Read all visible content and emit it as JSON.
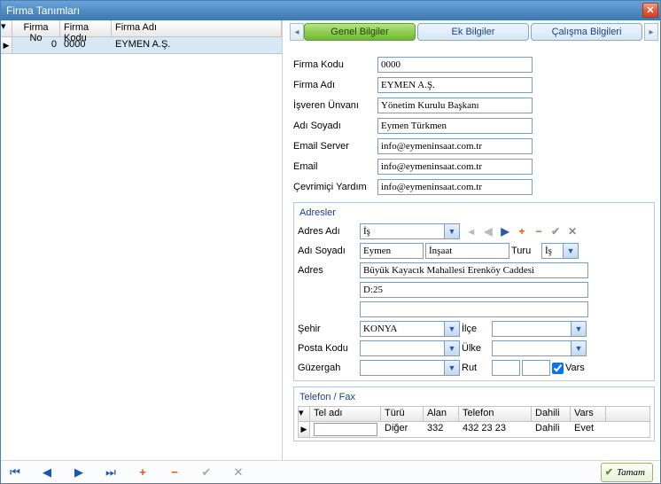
{
  "window": {
    "title": "Firma Tanımları"
  },
  "grid": {
    "columns": {
      "no": "Firma No",
      "kodu": "Firma Kodu",
      "adi": "Firma Adı"
    },
    "rows": [
      {
        "no": "0",
        "kodu": "0000",
        "adi": "EYMEN A.Ş."
      }
    ]
  },
  "tabs": {
    "genel": "Genel Bilgiler",
    "ek": "Ek Bilgiler",
    "calisma": "Çalışma Bilgileri"
  },
  "form": {
    "labels": {
      "firma_kodu": "Firma Kodu",
      "firma_adi": "Firma Adı",
      "isveren_unvani": "İşveren Ünvanı",
      "adi_soyadi": "Adı Soyadı",
      "email_server": "Email Server",
      "email": "Email",
      "cevrimici": "Çevrimiçi Yardım"
    },
    "values": {
      "firma_kodu": "0000",
      "firma_adi": "EYMEN A.Ş.",
      "isveren_unvani": "Yönetim Kurulu Başkanı",
      "adi_soyadi": "Eymen Türkmen",
      "email_server": "info@eymeninsaat.com.tr",
      "email": "info@eymeninsaat.com.tr",
      "cevrimici": "info@eymeninsaat.com.tr"
    }
  },
  "address": {
    "legend": "Adresler",
    "labels": {
      "adres_adi": "Adres Adı",
      "adi_soyadi": "Adı Soyadı",
      "turu": "Turu",
      "adres": "Adres",
      "sehir": "Şehir",
      "ilce": "İlçe",
      "posta": "Posta Kodu",
      "ulke": "Ülke",
      "guzergah": "Güzergah",
      "rut": "Rut",
      "vars": "Vars"
    },
    "values": {
      "adres_adi": "İş",
      "ad": "Eymen",
      "soyad": "İnşaat",
      "turu": "İş",
      "adres1": "Büyük Kayacık Mahallesi Erenköy Caddesi",
      "adres2": "D:25",
      "adres3": "",
      "sehir": "KONYA",
      "ilce": "",
      "posta": "",
      "ulke": "",
      "guzergah": "",
      "rut1": "",
      "rut2": ""
    }
  },
  "phone": {
    "legend": "Telefon / Fax",
    "columns": {
      "tel_adi": "Tel adı",
      "turu": "Türü",
      "alan": "Alan",
      "telefon": "Telefon",
      "dahili": "Dahili",
      "vars": "Vars"
    },
    "rows": [
      {
        "tel_adi": "",
        "turu": "Diğer",
        "alan": "332",
        "telefon": "432 23 23",
        "dahili": "Dahili",
        "vars": "Evet"
      }
    ]
  },
  "footer": {
    "ok": "Tamam"
  }
}
